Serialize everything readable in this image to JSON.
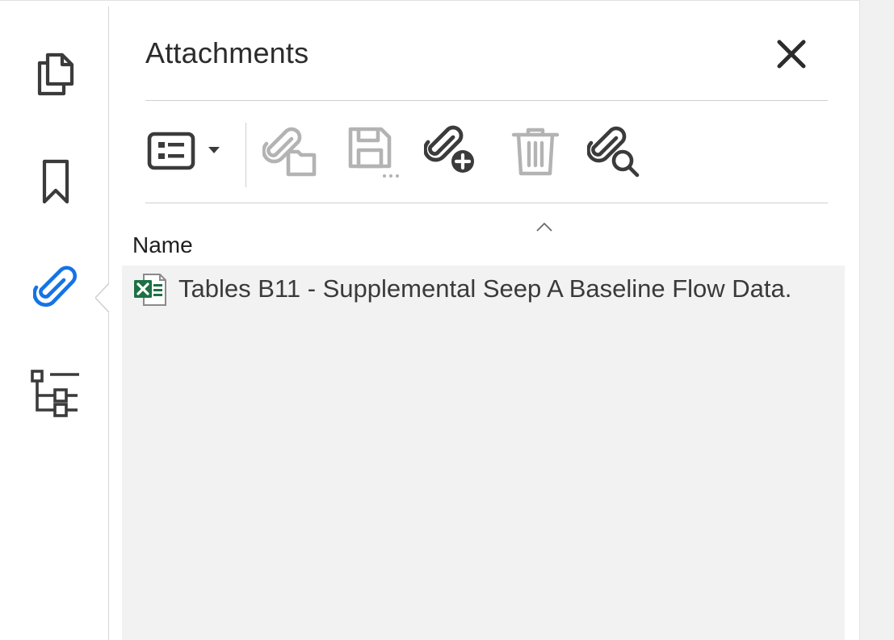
{
  "panel": {
    "title": "Attachments"
  },
  "rail": {
    "items": [
      {
        "icon": "pages-icon",
        "active": false
      },
      {
        "icon": "bookmark-icon",
        "active": false
      },
      {
        "icon": "paperclip-icon",
        "active": true
      },
      {
        "icon": "structure-tree-icon",
        "active": false
      }
    ]
  },
  "toolbar": {
    "buttons": [
      {
        "icon": "view-options-icon",
        "enabled": true
      },
      {
        "icon": "open-attachment-icon",
        "enabled": false
      },
      {
        "icon": "save-attachment-icon",
        "enabled": false
      },
      {
        "icon": "add-attachment-icon",
        "enabled": true
      },
      {
        "icon": "delete-attachment-icon",
        "enabled": false
      },
      {
        "icon": "search-attachment-icon",
        "enabled": true
      }
    ]
  },
  "list": {
    "columns": [
      "Name"
    ],
    "rows": [
      {
        "icon": "excel-file-icon",
        "name": "Tables B11 - Supplemental Seep A Baseline Flow Data."
      }
    ]
  },
  "colors": {
    "accent": "#1473e6",
    "icon": "#3b3b3b",
    "disabled_icon": "#b3b3b3",
    "excel_green": "#1d7044"
  }
}
